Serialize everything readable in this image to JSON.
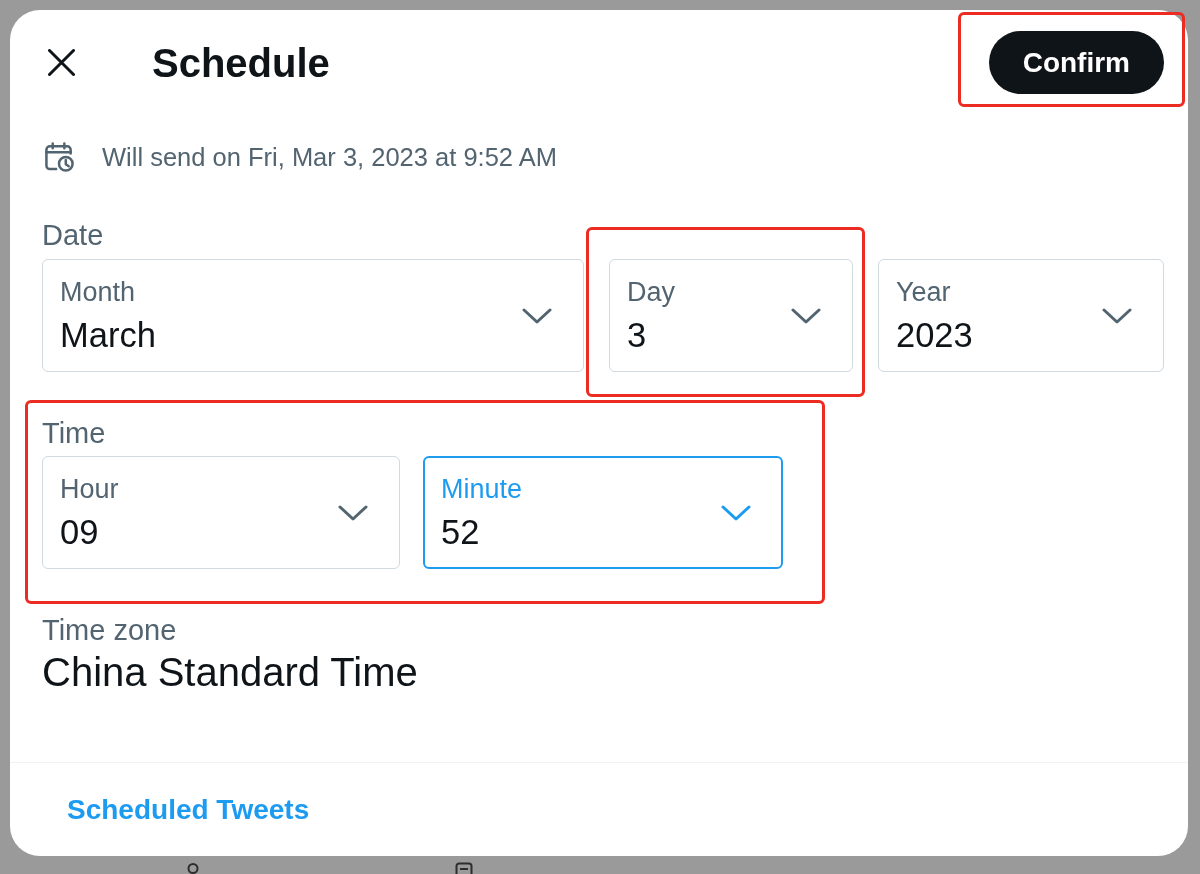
{
  "dialog": {
    "title": "Schedule",
    "confirm": {
      "label": "Confirm",
      "highlighted": true
    },
    "summary": "Will send on Fri, Mar 3, 2023 at 9:52 AM",
    "date": {
      "label": "Date",
      "fields": [
        {
          "label": "Month",
          "value": "March",
          "focused": false,
          "highlighted": false
        },
        {
          "label": "Day",
          "value": "3",
          "focused": false,
          "highlighted": true
        },
        {
          "label": "Year",
          "value": "2023",
          "focused": false,
          "highlighted": false
        }
      ]
    },
    "time": {
      "label": "Time",
      "highlighted": true,
      "fields": [
        {
          "label": "Hour",
          "value": "09",
          "focused": false
        },
        {
          "label": "Minute",
          "value": "52",
          "focused": true
        }
      ]
    },
    "time_zone": {
      "label": "Time zone",
      "value": "China Standard Time"
    },
    "footer_link": "Scheduled Tweets"
  }
}
